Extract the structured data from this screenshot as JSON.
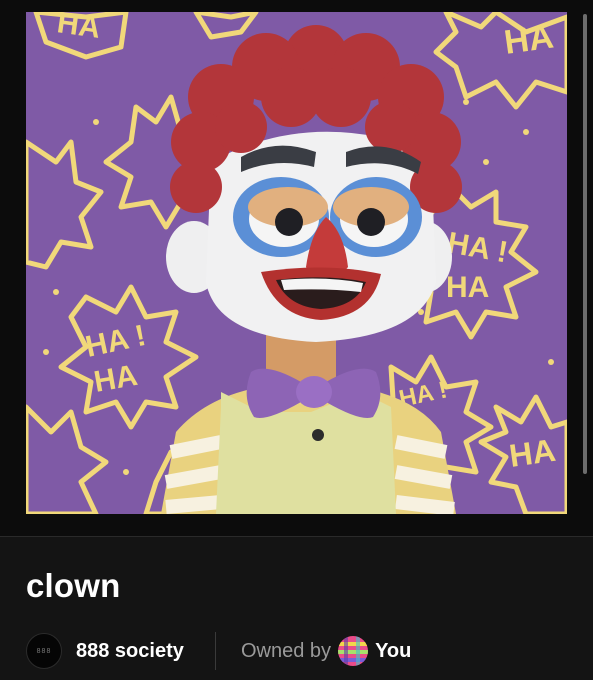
{
  "item": {
    "title": "clown",
    "image_alt": "clown"
  },
  "collection": {
    "name": "888 society",
    "avatar_text": "888"
  },
  "ownership": {
    "owned_by_label": "Owned by",
    "owner_name": "You"
  },
  "artwork_text": {
    "ha": "HA",
    "ha_bang": "HA !"
  },
  "colors": {
    "background": "#141414",
    "art_background": "#7f5aa6",
    "burst": "#f1d87a",
    "hair": "#b3363a",
    "bowtie": "#8d64b5",
    "shirt": "#dfe0a0"
  },
  "icons": {
    "collection_avatar": "collection-logo-icon",
    "owner_avatar": "owner-avatar-icon"
  }
}
